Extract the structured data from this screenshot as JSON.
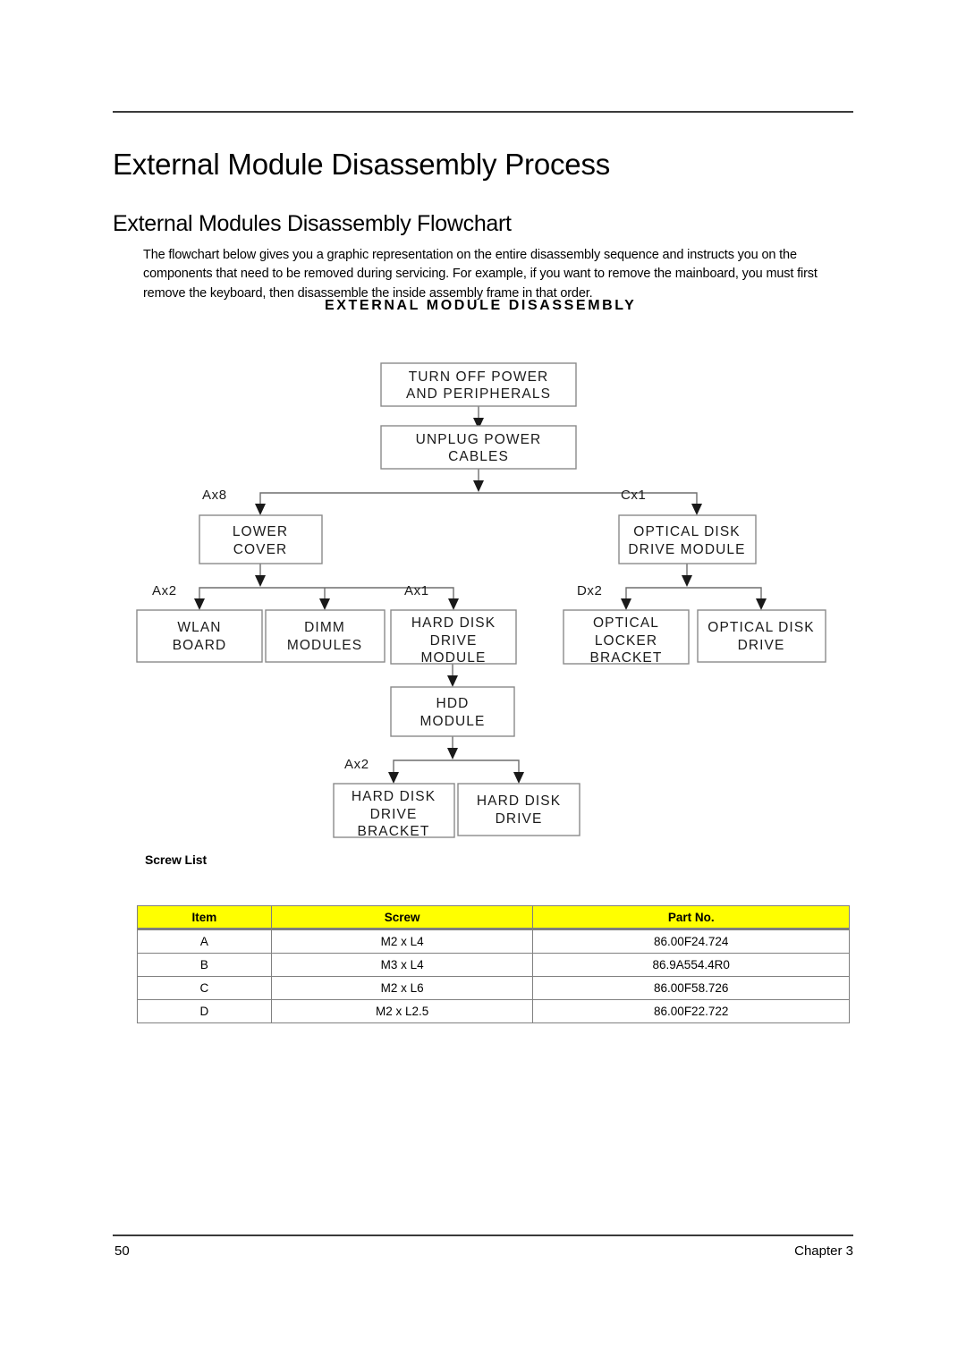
{
  "document": {
    "title": "External Module Disassembly Process",
    "subtitle": "External Modules Disassembly Flowchart",
    "intro": "The flowchart below gives you a graphic representation on the entire disassembly sequence and instructs you on the components that need to be removed during servicing. For example, if you want to remove the mainboard, you must first remove the keyboard, then disassemble the inside assembly frame in that order."
  },
  "flowchart": {
    "title": "EXTERNAL MODULE DISASSEMBLY",
    "nodes": {
      "turn_off_power": {
        "line1": "TURN OFF POWER",
        "line2": "AND PERIPHERALS"
      },
      "unplug_power": {
        "line1": "UNPLUG POWER",
        "line2": "CABLES"
      },
      "lower_cover": {
        "line1": "LOWER",
        "line2": "COVER"
      },
      "odd_module": {
        "line1": "OPTICAL DISK",
        "line2": "DRIVE MODULE"
      },
      "wlan_board": {
        "line1": "WLAN",
        "line2": "BOARD"
      },
      "dimm_modules": {
        "line1": "DIMM",
        "line2": "MODULES"
      },
      "hdd_drive_module": {
        "line1": "HARD DISK",
        "line2": "DRIVE",
        "line3": "MODULE"
      },
      "optical_locker_bracket": {
        "line1": "OPTICAL",
        "line2": "LOCKER",
        "line3": "BRACKET"
      },
      "optical_disk_drive": {
        "line1": "OPTICAL DISK",
        "line2": "DRIVE"
      },
      "hdd_module": {
        "line1": "HDD",
        "line2": "MODULE"
      },
      "hdd_bracket": {
        "line1": "HARD DISK",
        "line2": "DRIVE",
        "line3": "BRACKET"
      },
      "hdd_drive": {
        "line1": "HARD DISK",
        "line2": "DRIVE"
      }
    },
    "screw_tags": {
      "lower_cover": "Ax8",
      "odd_module": "Cx1",
      "wlan_board": "Ax2",
      "hdd_drive_module": "Ax1",
      "optical_locker_bracket": "Dx2",
      "hdd_bracket": "Ax2"
    }
  },
  "screw_list": {
    "heading": "Screw List",
    "columns": [
      "Item",
      "Screw",
      "Part No."
    ],
    "rows": [
      {
        "item": "A",
        "screw": "M2 x L4",
        "part_no": "86.00F24.724"
      },
      {
        "item": "B",
        "screw": "M3 x L4",
        "part_no": "86.9A554.4R0"
      },
      {
        "item": "C",
        "screw": "M2 x L6",
        "part_no": "86.00F58.726"
      },
      {
        "item": "D",
        "screw": "M2 x L2.5",
        "part_no": "86.00F22.722"
      }
    ],
    "header_background": "#FFFF00"
  },
  "footer": {
    "page_number": "50",
    "chapter": "Chapter 3"
  }
}
